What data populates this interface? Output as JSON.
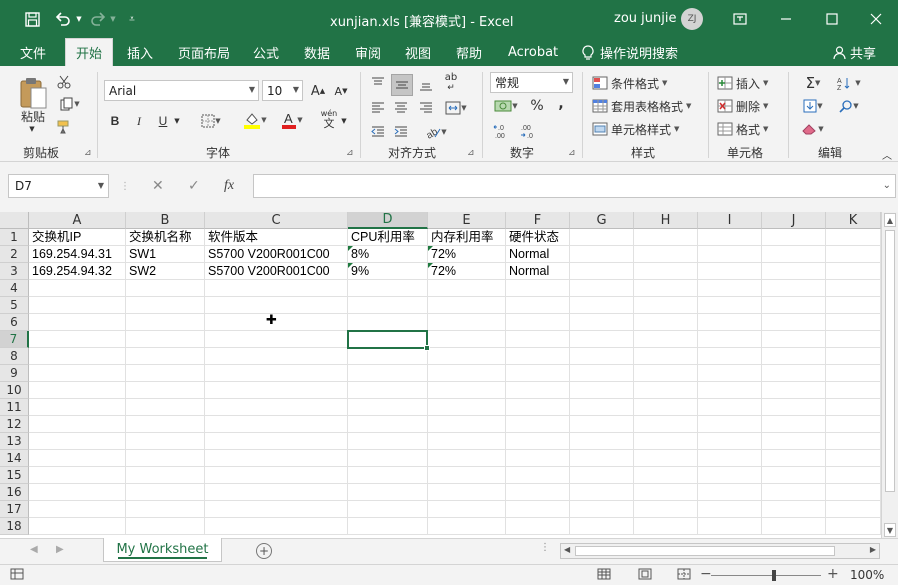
{
  "titlebar": {
    "title": "xunjian.xls  [兼容模式]  -  Excel",
    "user": "zou junjie",
    "avatar_initials": "ZJ",
    "icons": [
      "save-icon",
      "undo-icon",
      "redo-icon",
      "customize-icon",
      "ribbon-display-icon",
      "minimize-icon",
      "maximize-icon",
      "close-icon"
    ]
  },
  "tabs": {
    "file": "文件",
    "home": "开始",
    "insert": "插入",
    "page_layout": "页面布局",
    "formulas": "公式",
    "data": "数据",
    "review": "审阅",
    "view": "视图",
    "help": "帮助",
    "acrobat": "Acrobat",
    "tell_me": "操作说明搜索",
    "share": "共享"
  },
  "ribbon": {
    "clipboard": {
      "label": "剪贴板",
      "paste": "粘贴"
    },
    "font": {
      "label": "字体",
      "font_name": "Arial",
      "font_size": "10",
      "bold": "B",
      "italic": "I",
      "underline": "U",
      "wen_top": "wén",
      "wen": "文"
    },
    "alignment": {
      "label": "对齐方式",
      "wrap": "ab"
    },
    "number": {
      "label": "数字",
      "format": "常规",
      "percent": "%",
      "comma": ",",
      "inc_decimal": "←.0\n.00",
      "dec_decimal": ".00\n→.0"
    },
    "styles": {
      "label": "样式",
      "conditional": "条件格式",
      "table": "套用表格格式",
      "cell_styles": "单元格样式"
    },
    "cells": {
      "label": "单元格",
      "insert": "插入",
      "delete": "删除",
      "format": "格式"
    },
    "editing": {
      "label": "编辑",
      "sigma": "Σ"
    }
  },
  "formula_bar": {
    "name_box": "D7",
    "fx": "fx",
    "formula": ""
  },
  "grid": {
    "columns": [
      "A",
      "B",
      "C",
      "D",
      "E",
      "F",
      "G",
      "H",
      "I",
      "J",
      "K"
    ],
    "selected_column": "D",
    "selected_row": "7",
    "rows": [
      "1",
      "2",
      "3",
      "4",
      "5",
      "6",
      "7",
      "8",
      "9",
      "10",
      "11",
      "12",
      "13",
      "14",
      "15",
      "16",
      "17",
      "18"
    ],
    "cells": {
      "A1": "交换机IP",
      "B1": "交换机名称",
      "C1": "软件版本",
      "D1": "CPU利用率",
      "E1": "内存利用率",
      "F1": "硬件状态",
      "A2": "169.254.94.31",
      "B2": "SW1",
      "C2": "S5700 V200R001C00",
      "D2": "8%",
      "E2": "72%",
      "F2": "Normal",
      "A3": "169.254.94.32",
      "B3": "SW2",
      "C3": "S5700 V200R001C00",
      "D3": "9%",
      "E3": "72%",
      "F3": "Normal"
    }
  },
  "sheets": {
    "active": "My Worksheet"
  },
  "status": {
    "zoom": "100%",
    "zoom_minus": "−",
    "zoom_plus": "+"
  }
}
